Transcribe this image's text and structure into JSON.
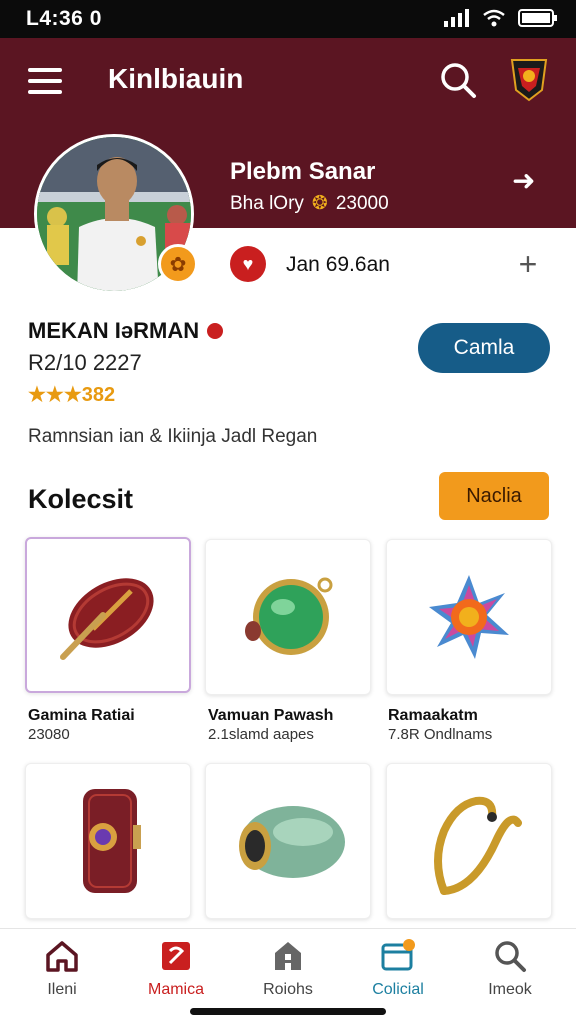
{
  "status_bar": {
    "time": "L4:36 0"
  },
  "appbar": {
    "title": "Kinlbiauin"
  },
  "profile": {
    "name": "Plebm Sanar",
    "meta": "Bha lOry",
    "coins": "23000",
    "date_text": "Jan 69.6an"
  },
  "player": {
    "name": "MEKAN IəRMAN",
    "id": "R2/10 2227",
    "rating": "★★★382",
    "cta": "Camla",
    "description": "Ramnsian ian & Ikiinja Jadl Regan"
  },
  "collection": {
    "title": "Kolecsit",
    "button": "Naclia",
    "items": [
      {
        "title": "Gamina Ratiai",
        "sub": "23080",
        "icon": "rugby-ball-icon"
      },
      {
        "title": "Vamuan Pawash",
        "sub": "2.1slamd aapes",
        "icon": "green-medallion-icon"
      },
      {
        "title": "Ramaakatm",
        "sub": "7.8R Ondlnams",
        "icon": "sun-gem-icon"
      },
      {
        "title": "",
        "sub": "",
        "icon": "wrist-band-icon"
      },
      {
        "title": "",
        "sub": "",
        "icon": "jade-stone-icon"
      },
      {
        "title": "",
        "sub": "",
        "icon": "gold-hook-icon"
      }
    ]
  },
  "bottom_nav": [
    {
      "label": "Ileni",
      "icon": "house-icon"
    },
    {
      "label": "Mamica",
      "icon": "card-icon"
    },
    {
      "label": "Roiohs",
      "icon": "building-icon"
    },
    {
      "label": "Colicial",
      "icon": "wallet-icon"
    },
    {
      "label": "Imeok",
      "icon": "search-icon"
    }
  ],
  "colors": {
    "brand_maroon": "#5b1522",
    "primary_blue": "#165c88",
    "accent_orange": "#f29a1c",
    "active_red": "#c91f1f"
  }
}
